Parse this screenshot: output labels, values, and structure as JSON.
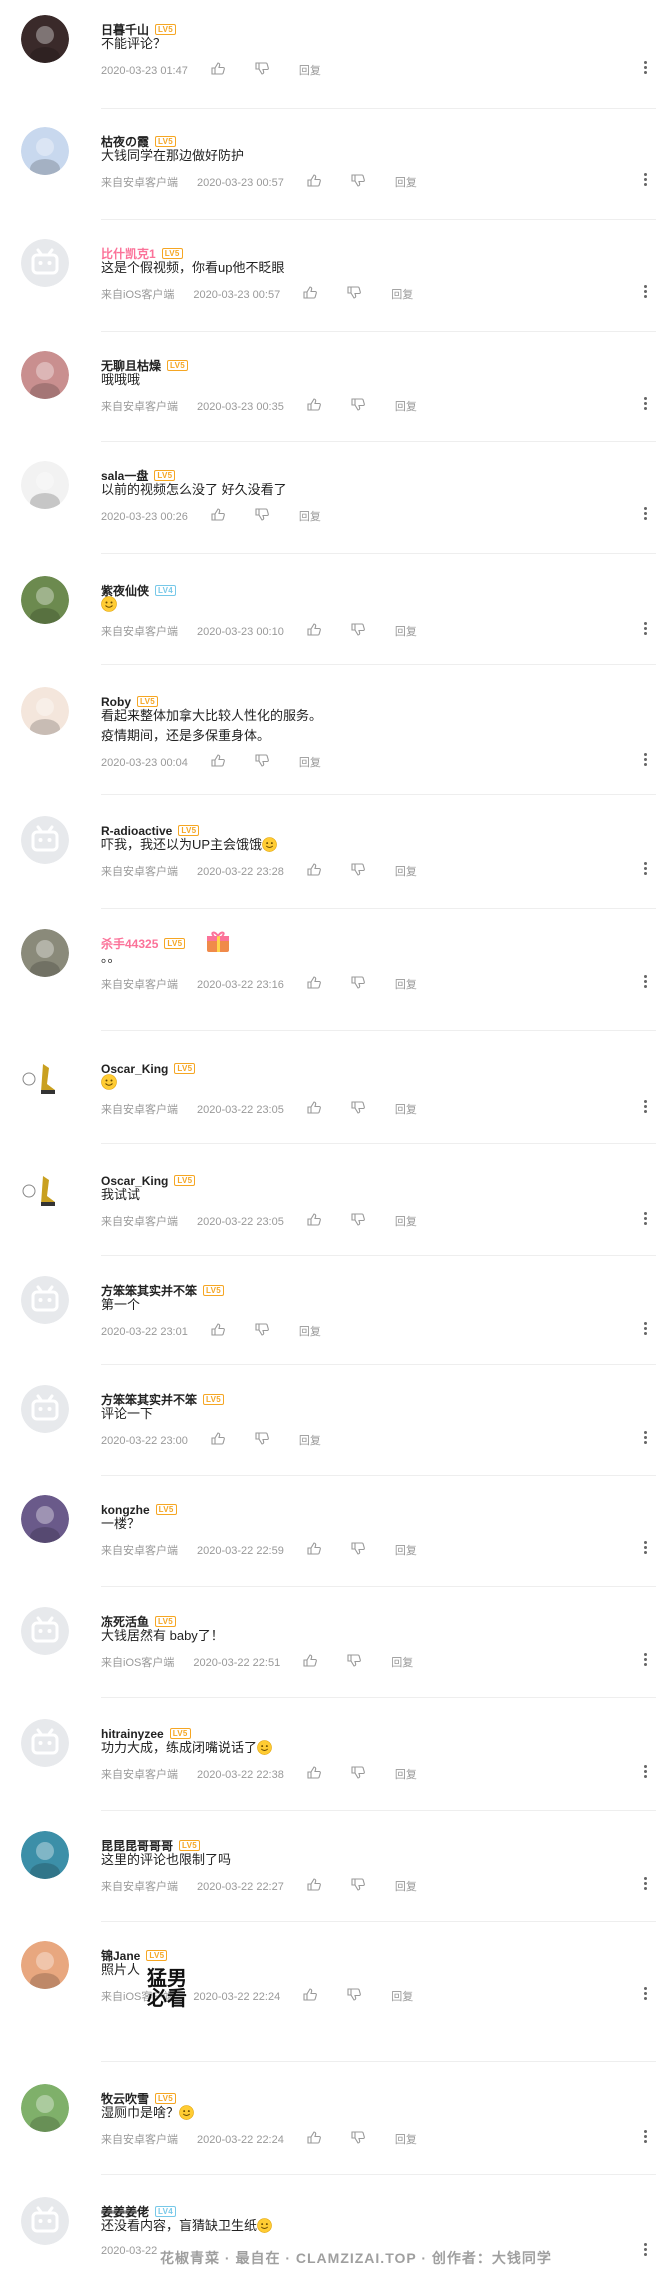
{
  "comments": [
    {
      "user": "日暮千山",
      "name_color": "#222222",
      "level": "LV5",
      "text": [
        "不能评论？"
      ],
      "source": "",
      "time": "2020-03-23 01:47",
      "reply": "回复",
      "avatar": "dark"
    },
    {
      "user": "枯夜の霞",
      "name_color": "#222222",
      "level": "LV5",
      "text": [
        "大钱同学在那边做好防护"
      ],
      "source": "来自安卓客户端",
      "time": "2020-03-23 00:57",
      "reply": "回复",
      "avatar": "anime-blue"
    },
    {
      "user": "比什凯克1",
      "name_color": "#fb7299",
      "level": "LV5",
      "text": [
        "这是个假视频，你看up他不眨眼"
      ],
      "source": "来自iOS客户端",
      "time": "2020-03-23 00:57",
      "reply": "回复",
      "avatar": "default"
    },
    {
      "user": "无聊且枯燥",
      "name_color": "#222222",
      "level": "LV5",
      "text": [
        "哦哦哦"
      ],
      "source": "来自安卓客户端",
      "time": "2020-03-23 00:35",
      "reply": "回复",
      "avatar": "pink"
    },
    {
      "user": "sala一盘",
      "name_color": "#222222",
      "level": "LV5",
      "text": [
        "以前的视频怎么没了 好久没看了"
      ],
      "source": "",
      "time": "2020-03-23 00:26",
      "reply": "回复",
      "avatar": "white-cat"
    },
    {
      "user": "紫夜仙侠",
      "name_color": "#222222",
      "level": "LV4",
      "text": [
        ""
      ],
      "source": "来自安卓客户端",
      "time": "2020-03-23 00:10",
      "reply": "回复",
      "avatar": "green"
    },
    {
      "user": "Roby",
      "name_color": "#222222",
      "level": "LV5",
      "text": [
        "看起来整体加拿大比较人性化的服务。",
        "疫情期间，还是多保重身体。"
      ],
      "source": "",
      "time": "2020-03-23 00:04",
      "reply": "回复",
      "avatar": "fish"
    },
    {
      "user": "R-adioactive",
      "name_color": "#222222",
      "level": "LV5",
      "text": [
        "吓我，我还以为UP主会饿饿"
      ],
      "source": "来自安卓客户端",
      "time": "2020-03-22 23:28",
      "reply": "回复",
      "avatar": "default"
    },
    {
      "user": "杀手44325",
      "name_color": "#fb7299",
      "level": "LV5",
      "text": [
        "。。"
      ],
      "source": "来自安卓客户端",
      "time": "2020-03-22 23:16",
      "reply": "回复",
      "avatar": "panda"
    },
    {
      "user": "Oscar_King",
      "name_color": "#222222",
      "level": "LV5",
      "text": [
        ""
      ],
      "source": "来自安卓客户端",
      "time": "2020-03-22 23:05",
      "reply": "回复",
      "avatar": "oscar"
    },
    {
      "user": "Oscar_King",
      "name_color": "#222222",
      "level": "LV5",
      "text": [
        "我试试"
      ],
      "source": "来自安卓客户端",
      "time": "2020-03-22 23:05",
      "reply": "回复",
      "avatar": "oscar"
    },
    {
      "user": "方笨笨其实并不笨",
      "name_color": "#222222",
      "level": "LV5",
      "text": [
        "第一个"
      ],
      "source": "",
      "time": "2020-03-22 23:01",
      "reply": "回复",
      "avatar": "default"
    },
    {
      "user": "方笨笨其实并不笨",
      "name_color": "#222222",
      "level": "LV5",
      "text": [
        "评论一下"
      ],
      "source": "",
      "time": "2020-03-22 23:00",
      "reply": "回复",
      "avatar": "default"
    },
    {
      "user": "kongzhe",
      "name_color": "#222222",
      "level": "LV5",
      "text": [
        "一楼？"
      ],
      "source": "来自安卓客户端",
      "time": "2020-03-22 22:59",
      "reply": "回复",
      "avatar": "colorful"
    },
    {
      "user": "冻死活鱼",
      "name_color": "#222222",
      "level": "LV5",
      "text": [
        "大钱居然有 baby了！"
      ],
      "source": "来自iOS客户端",
      "time": "2020-03-22 22:51",
      "reply": "回复",
      "avatar": "default"
    },
    {
      "user": "hitrainyzee",
      "name_color": "#222222",
      "level": "LV5",
      "text": [
        "功力大成，练成闭嘴说话了"
      ],
      "source": "来自安卓客户端",
      "time": "2020-03-22 22:38",
      "reply": "回复",
      "avatar": "default"
    },
    {
      "user": "昆昆昆哥哥哥",
      "name_color": "#222222",
      "level": "LV5",
      "text": [
        "这里的评论也限制了吗"
      ],
      "source": "来自安卓客户端",
      "time": "2020-03-22 22:27",
      "reply": "回复",
      "avatar": "teal"
    },
    {
      "user": "锦Jane",
      "name_color": "#222222",
      "level": "LV5",
      "text": [
        "照片人"
      ],
      "source": "来自iOS客户端",
      "time": "2020-03-22 22:24",
      "reply": "回复",
      "avatar": "peach"
    },
    {
      "user": "牧云吹雪",
      "name_color": "#222222",
      "level": "LV5",
      "text": [
        "湿厕巾是啥？"
      ],
      "source": "来自安卓客户端",
      "time": "2020-03-22 22:24",
      "reply": "回复",
      "avatar": "garden"
    },
    {
      "user": "姜姜姜佬",
      "name_color": "#222222",
      "level": "LV4",
      "text": [
        "还没看内容，盲猜缺卫生纸"
      ],
      "source": "",
      "time": "2020-03-22",
      "reply": "",
      "avatar": "default"
    }
  ],
  "sticker_text": [
    "猛男",
    "必看"
  ],
  "watermark": "花椒青菜 · 最自在 · CLAMZIZAI.TOP · 创作者：大钱同学"
}
